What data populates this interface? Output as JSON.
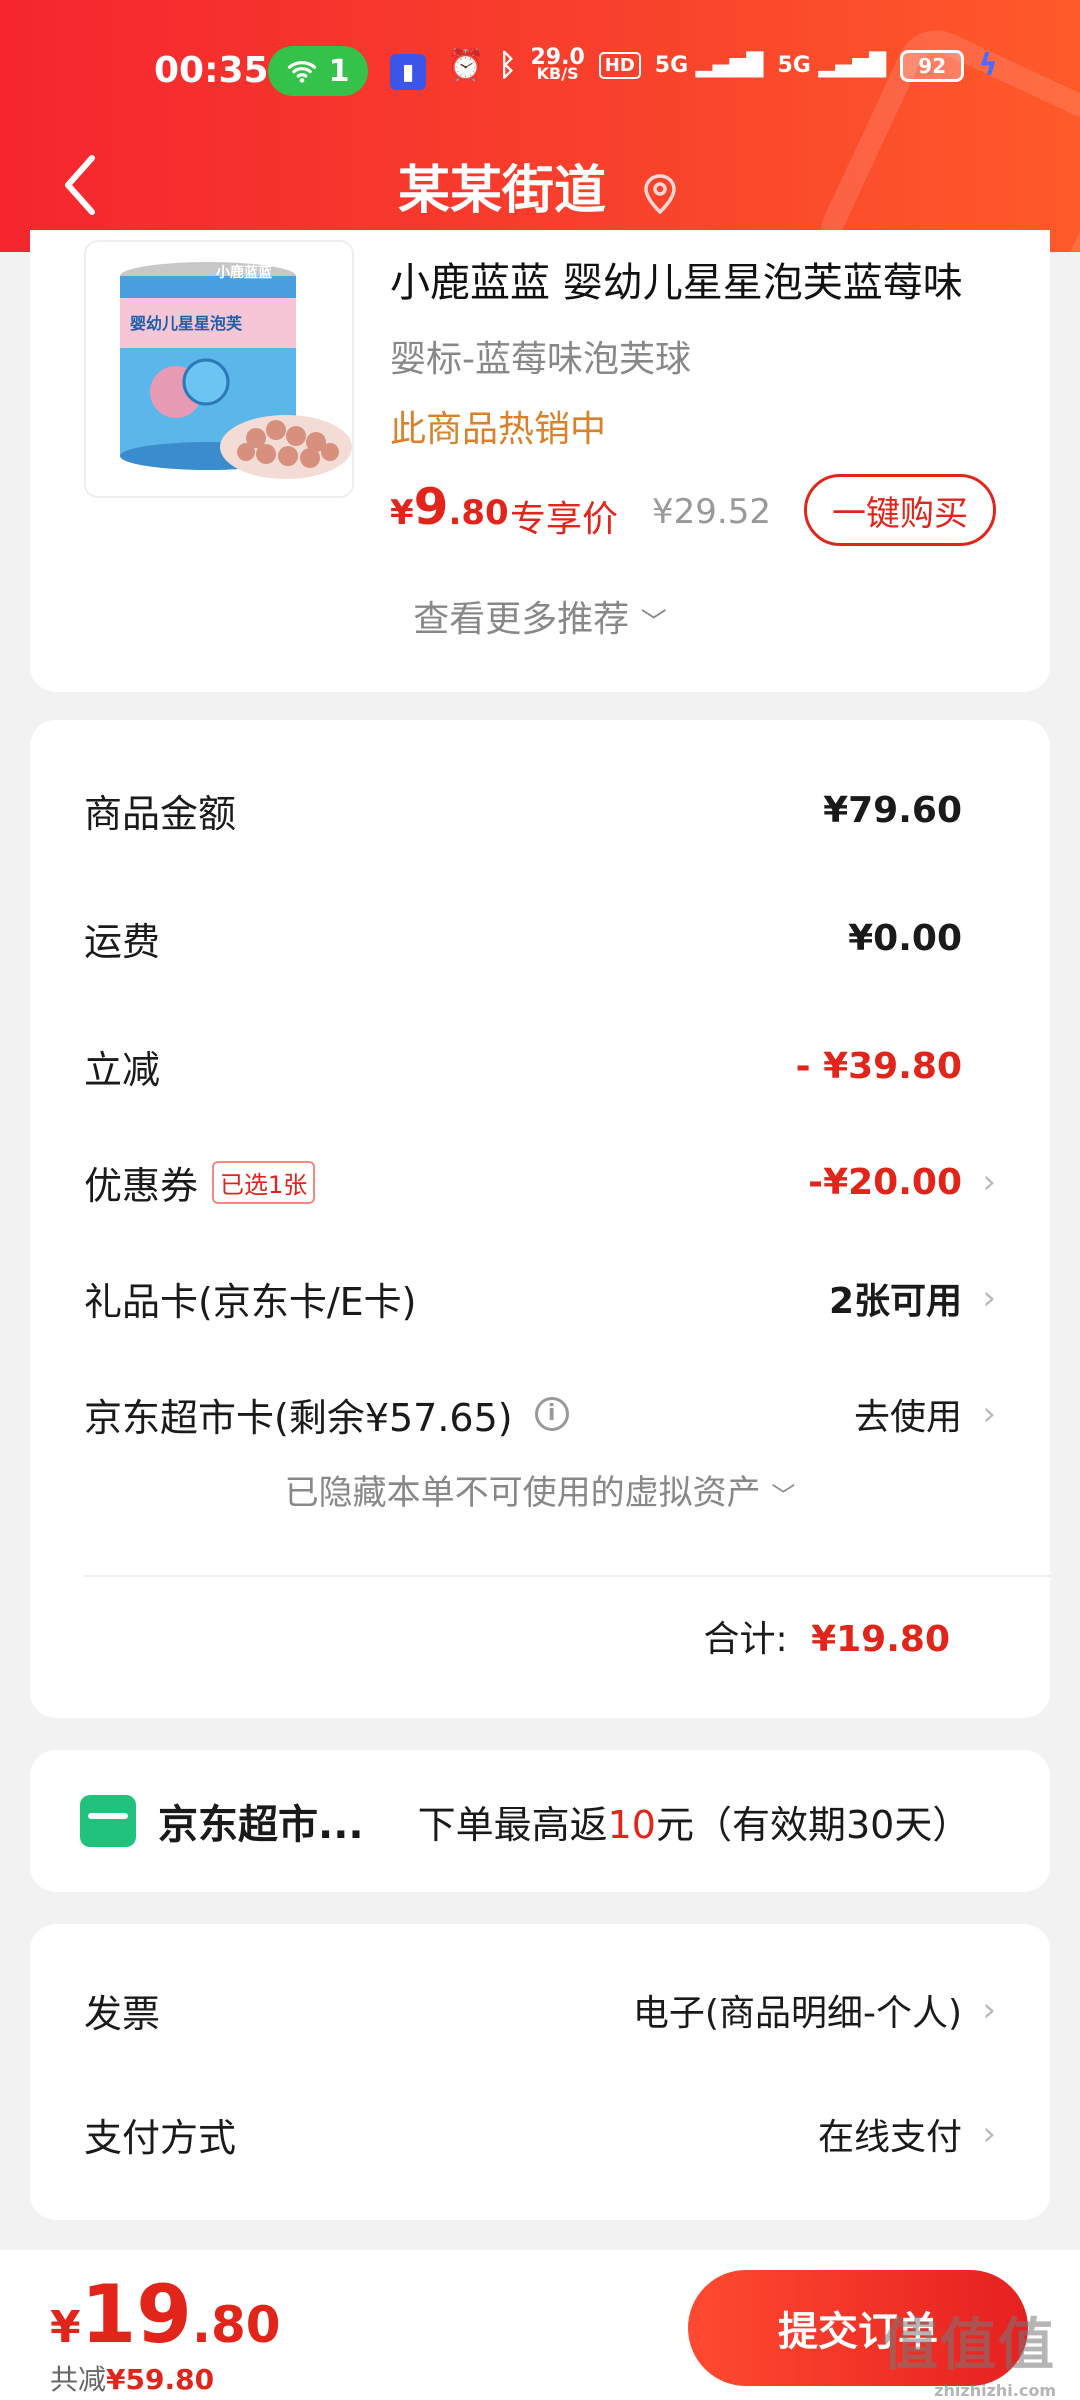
{
  "status_bar": {
    "time": "00:35",
    "wifi_badge": "1",
    "net_speed_value": "29.0",
    "net_speed_unit": "KB/S",
    "hd": "HD",
    "signal1": "5G",
    "signal2": "5G",
    "battery": "92"
  },
  "nav": {
    "title": "某某街道"
  },
  "product": {
    "name": "小鹿蓝蓝 婴幼儿星星泡芙蓝莓味",
    "spec": "婴标-蓝莓味泡芙球",
    "hot_text": "此商品热销中",
    "price_symbol": "¥",
    "price_int": "9",
    "price_dec": ".80",
    "price_tag": "专享价",
    "orig_price": "¥29.52",
    "buy_label": "一键购买",
    "more_rec": "查看更多推荐",
    "image_brand": "小鹿蓝蓝",
    "image_label": "婴幼儿星星泡芙"
  },
  "fees": {
    "goods_label": "商品金额",
    "goods_value": "¥79.60",
    "shipping_label": "运费",
    "shipping_value": "¥0.00",
    "discount_label": "立减",
    "discount_value": "- ¥39.80",
    "coupon_label": "优惠券",
    "coupon_badge": "已选1张",
    "coupon_value": "-¥20.00",
    "giftcard_label": "礼品卡(京东卡/E卡)",
    "giftcard_value": "2张可用",
    "supercard_label": "京东超市卡(剩余¥57.65)",
    "supercard_value": "去使用",
    "hidden_assets": "已隐藏本单不可使用的虚拟资产",
    "total_label": "合计:",
    "total_value": "¥19.80"
  },
  "promo": {
    "name": "京东超市...",
    "text_before": "下单最高返",
    "text_highlight": "10",
    "text_after": "元（有效期30天）"
  },
  "misc": {
    "invoice_label": "发票",
    "invoice_value": "电子(商品明细-个人)",
    "payment_label": "支付方式",
    "payment_value": "在线支付"
  },
  "bottom": {
    "price_symbol": "¥",
    "price_int": "19",
    "price_dec": ".80",
    "saved_label": "共减",
    "saved_value": "¥59.80",
    "submit_label": "提交订单"
  },
  "watermark": {
    "text": "值值值",
    "sub": "zhizhizhi.com"
  },
  "colors": {
    "brand_red": "#e1251b",
    "header_red": "#f5262e",
    "hot_orange": "#d9822b",
    "card_green": "#20c27c"
  }
}
